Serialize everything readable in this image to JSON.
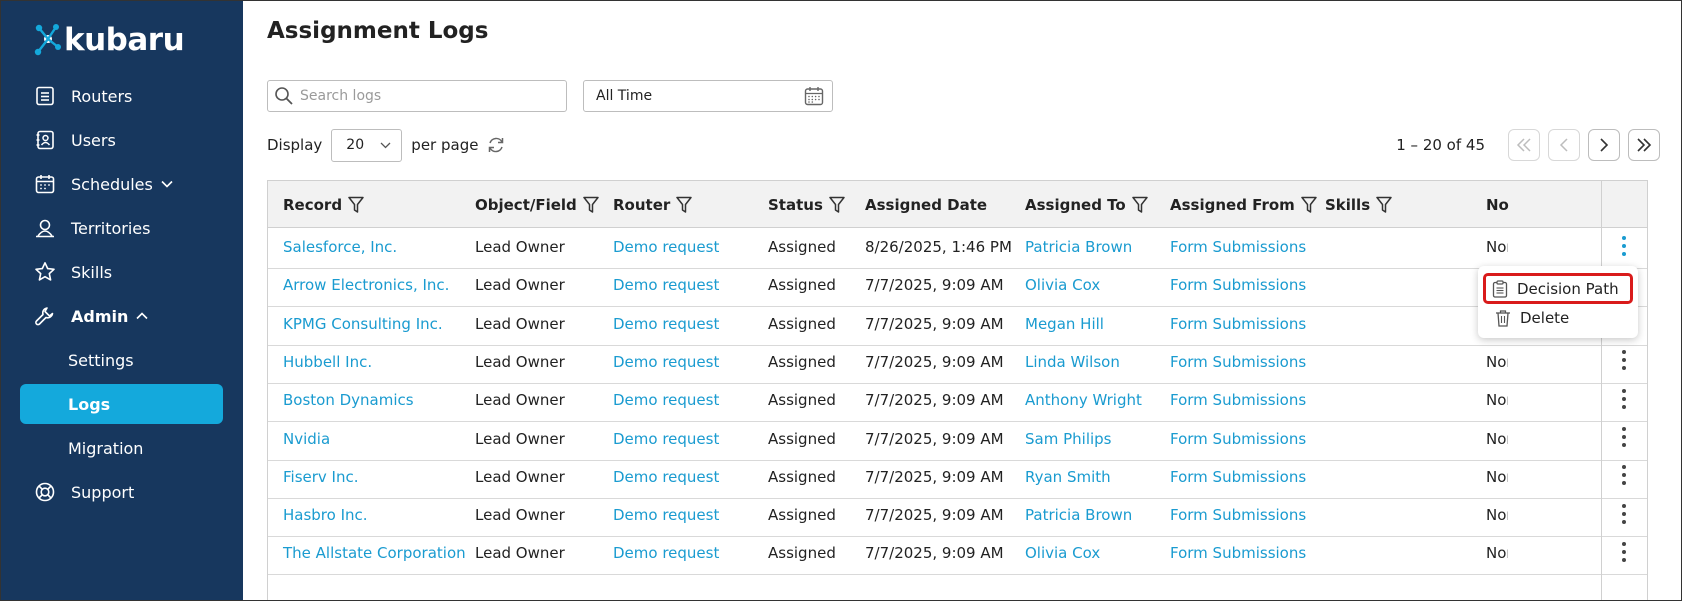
{
  "app": {
    "logo_text": "kubaru"
  },
  "sidebar": {
    "items": [
      {
        "label": "Routers",
        "icon": "list-icon"
      },
      {
        "label": "Users",
        "icon": "contact-book-icon"
      },
      {
        "label": "Schedules",
        "icon": "calendar-icon"
      },
      {
        "label": "Territories",
        "icon": "map-pin-person-icon"
      },
      {
        "label": "Skills",
        "icon": "star-icon"
      },
      {
        "label": "Admin",
        "icon": "wrench-icon"
      },
      {
        "label": "Settings"
      },
      {
        "label": "Logs"
      },
      {
        "label": "Migration"
      },
      {
        "label": "Support",
        "icon": "lifebuoy-icon"
      }
    ],
    "active": "Logs"
  },
  "page": {
    "title": "Assignment Logs"
  },
  "search": {
    "placeholder": "Search logs",
    "value": ""
  },
  "date_filter": {
    "value": "All Time"
  },
  "display": {
    "label": "Display",
    "page_size": "20",
    "suffix": "per page"
  },
  "pager": {
    "range_text": "1 – 20 of 45"
  },
  "table": {
    "columns": [
      "Record",
      "Object/Field",
      "Router",
      "Status",
      "Assigned Date",
      "Assigned To",
      "Assigned From",
      "Skills",
      "No"
    ],
    "rows": [
      [
        "Salesforce, Inc.",
        "Lead Owner",
        "Demo request",
        "Assigned",
        "8/26/2025, 1:46 PM",
        "Patricia Brown",
        "Form Submissions",
        "",
        "Nor"
      ],
      [
        "Arrow Electronics, Inc.",
        "Lead Owner",
        "Demo request",
        "Assigned",
        "7/7/2025, 9:09 AM",
        "Olivia Cox",
        "Form Submissions",
        "",
        ""
      ],
      [
        "KPMG Consulting Inc.",
        "Lead Owner",
        "Demo request",
        "Assigned",
        "7/7/2025, 9:09 AM",
        "Megan Hill",
        "Form Submissions",
        "",
        ""
      ],
      [
        "Hubbell Inc.",
        "Lead Owner",
        "Demo request",
        "Assigned",
        "7/7/2025, 9:09 AM",
        "Linda Wilson",
        "Form Submissions",
        "",
        "Nor"
      ],
      [
        "Boston Dynamics",
        "Lead Owner",
        "Demo request",
        "Assigned",
        "7/7/2025, 9:09 AM",
        "Anthony Wright",
        "Form Submissions",
        "",
        "Nor"
      ],
      [
        "Nvidia",
        "Lead Owner",
        "Demo request",
        "Assigned",
        "7/7/2025, 9:09 AM",
        "Sam Philips",
        "Form Submissions",
        "",
        "Nor"
      ],
      [
        "Fiserv Inc.",
        "Lead Owner",
        "Demo request",
        "Assigned",
        "7/7/2025, 9:09 AM",
        "Ryan Smith",
        "Form Submissions",
        "",
        "Nor"
      ],
      [
        "Hasbro Inc.",
        "Lead Owner",
        "Demo request",
        "Assigned",
        "7/7/2025, 9:09 AM",
        "Patricia Brown",
        "Form Submissions",
        "",
        "Nor"
      ],
      [
        "The Allstate Corporation",
        "Lead Owner",
        "Demo request",
        "Assigned",
        "7/7/2025, 9:09 AM",
        "Olivia Cox",
        "Form Submissions",
        "",
        "Nor"
      ]
    ]
  },
  "row_menu": {
    "items": [
      {
        "label": "Decision Path",
        "icon": "clipboard-icon",
        "highlighted": true
      },
      {
        "label": "Delete",
        "icon": "trash-icon"
      }
    ]
  },
  "colors": {
    "sidebar_bg": "#17375e",
    "accent": "#14a9dc",
    "link": "#1a9bd0",
    "highlight": "#d91b1b"
  }
}
